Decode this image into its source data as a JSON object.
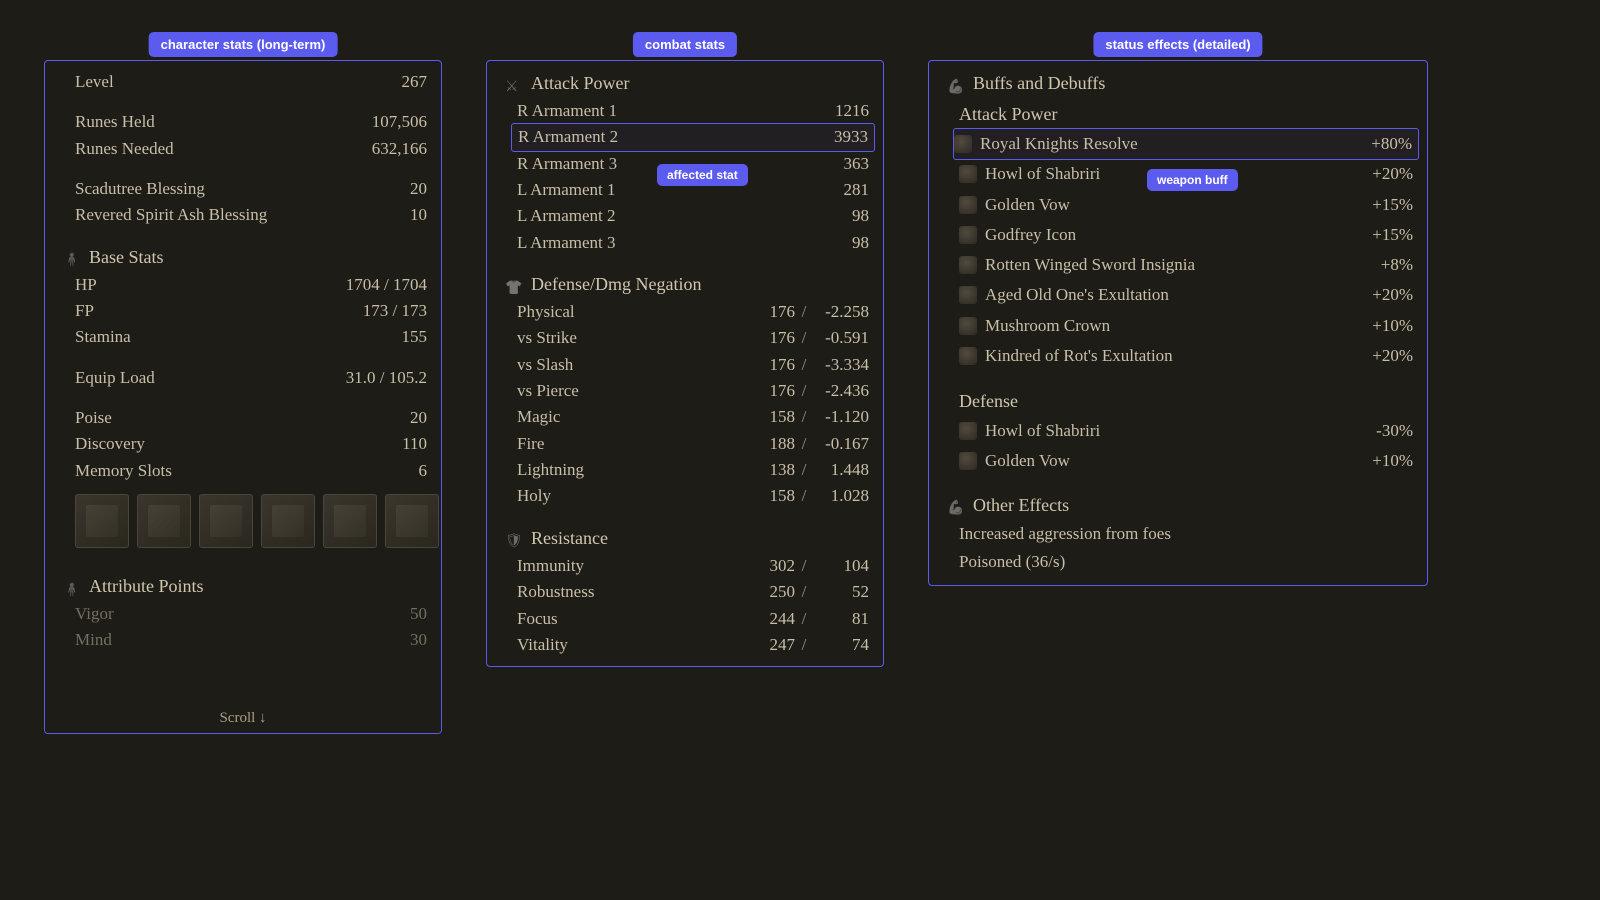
{
  "panel1": {
    "tag": "character stats (long-term)",
    "top": [
      {
        "label": "Level",
        "value": "267"
      }
    ],
    "runes": [
      {
        "label": "Runes Held",
        "value": "107,506"
      },
      {
        "label": "Runes Needed",
        "value": "632,166"
      }
    ],
    "blessings": [
      {
        "label": "Scadutree Blessing",
        "value": "20"
      },
      {
        "label": "Revered Spirit Ash Blessing",
        "value": "10"
      }
    ],
    "base_header": "Base Stats",
    "base": [
      {
        "label": "HP",
        "value": "1704 / 1704"
      },
      {
        "label": "FP",
        "value": "173 / 173"
      },
      {
        "label": "Stamina",
        "value": "155"
      }
    ],
    "equip": [
      {
        "label": "Equip Load",
        "value": "31.0 / 105.2"
      }
    ],
    "misc": [
      {
        "label": "Poise",
        "value": "20"
      },
      {
        "label": "Discovery",
        "value": "110"
      },
      {
        "label": "Memory Slots",
        "value": "6"
      }
    ],
    "attr_header": "Attribute Points",
    "attrs": [
      {
        "label": "Vigor",
        "value": "50"
      },
      {
        "label": "Mind",
        "value": "30"
      }
    ],
    "scroll": "Scroll ↓"
  },
  "panel2": {
    "tag": "combat stats",
    "atk_header": "Attack Power",
    "atk": [
      {
        "label": "R Armament 1",
        "value": "1216"
      },
      {
        "label": "R Armament 2",
        "value": "3933",
        "hl": true
      },
      {
        "label": "R Armament 3",
        "value": "363"
      },
      {
        "label": "L Armament 1",
        "value": "281"
      },
      {
        "label": "L Armament 2",
        "value": "98"
      },
      {
        "label": "L Armament 3",
        "value": "98"
      }
    ],
    "affected_tag": "affected stat",
    "def_header": "Defense/Dmg Negation",
    "def": [
      {
        "label": "Physical",
        "v1": "176",
        "v2": "-2.258"
      },
      {
        "label": "vs Strike",
        "v1": "176",
        "v2": "-0.591"
      },
      {
        "label": "vs Slash",
        "v1": "176",
        "v2": "-3.334"
      },
      {
        "label": "vs Pierce",
        "v1": "176",
        "v2": "-2.436"
      },
      {
        "label": "Magic",
        "v1": "158",
        "v2": "-1.120"
      },
      {
        "label": "Fire",
        "v1": "188",
        "v2": "-0.167"
      },
      {
        "label": "Lightning",
        "v1": "138",
        "v2": "1.448"
      },
      {
        "label": "Holy",
        "v1": "158",
        "v2": "1.028"
      }
    ],
    "res_header": "Resistance",
    "res": [
      {
        "label": "Immunity",
        "v1": "302",
        "v2": "104"
      },
      {
        "label": "Robustness",
        "v1": "250",
        "v2": "52"
      },
      {
        "label": "Focus",
        "v1": "244",
        "v2": "81"
      },
      {
        "label": "Vitality",
        "v1": "247",
        "v2": "74"
      }
    ]
  },
  "panel3": {
    "tag": "status effects (detailed)",
    "header": "Buffs and Debuffs",
    "atk_sub": "Attack Power",
    "atk_buffs": [
      {
        "label": "Royal Knights Resolve",
        "value": "+80%",
        "hl": true
      },
      {
        "label": "Howl of Shabriri",
        "value": "+20%"
      },
      {
        "label": "Golden Vow",
        "value": "+15%"
      },
      {
        "label": "Godfrey Icon",
        "value": "+15%"
      },
      {
        "label": "Rotten Winged Sword Insignia",
        "value": "+8%"
      },
      {
        "label": "Aged Old One's Exultation",
        "value": "+20%"
      },
      {
        "label": "Mushroom Crown",
        "value": "+10%"
      },
      {
        "label": "Kindred of Rot's Exultation",
        "value": "+20%"
      }
    ],
    "buff_tag": "weapon buff",
    "def_sub": "Defense",
    "def_buffs": [
      {
        "label": "Howl of Shabriri",
        "value": "-30%"
      },
      {
        "label": "Golden Vow",
        "value": "+10%"
      }
    ],
    "other_header": "Other Effects",
    "other": [
      "Increased aggression from foes",
      "Poisoned (36/s)"
    ]
  }
}
